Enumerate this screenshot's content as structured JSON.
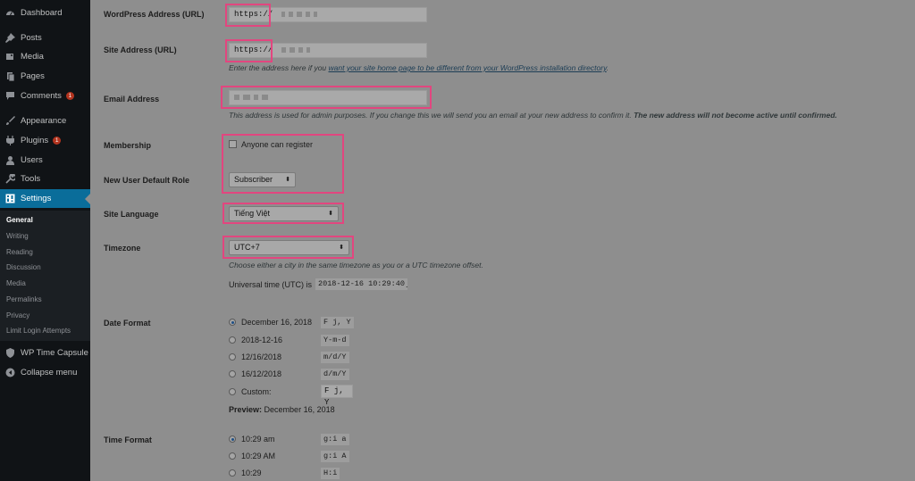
{
  "sidebar": {
    "items": [
      {
        "label": "Dashboard",
        "icon": "dashboard-icon"
      },
      {
        "label": "Posts",
        "icon": "pin-icon"
      },
      {
        "label": "Media",
        "icon": "media-icon"
      },
      {
        "label": "Pages",
        "icon": "pages-icon"
      },
      {
        "label": "Comments",
        "icon": "comment-icon",
        "badge": "1"
      },
      {
        "label": "Appearance",
        "icon": "paintbrush-icon"
      },
      {
        "label": "Plugins",
        "icon": "plug-icon",
        "badge": "1"
      },
      {
        "label": "Users",
        "icon": "user-icon"
      },
      {
        "label": "Tools",
        "icon": "wrench-icon"
      },
      {
        "label": "Settings",
        "icon": "settings-icon",
        "active": true
      },
      {
        "label": "WP Time Capsule",
        "icon": "shield-icon"
      },
      {
        "label": "Collapse menu",
        "icon": "collapse-icon"
      }
    ],
    "submenu": [
      "General",
      "Writing",
      "Reading",
      "Discussion",
      "Media",
      "Permalinks",
      "Privacy",
      "Limit Login Attempts"
    ]
  },
  "form": {
    "wp_address": {
      "label": "WordPress Address (URL)",
      "value": "https://"
    },
    "site_address": {
      "label": "Site Address (URL)",
      "value": "https://",
      "desc_prefix": "Enter the address here if you ",
      "desc_link": "want your site home page to be different from your WordPress installation directory",
      "desc_suffix": "."
    },
    "email": {
      "label": "Email Address",
      "desc": "This address is used for admin purposes. If you change this we will send you an email at your new address to confirm it. ",
      "desc_bold": "The new address will not become active until confirmed."
    },
    "membership": {
      "label": "Membership",
      "checkbox_label": "Anyone can register"
    },
    "default_role": {
      "label": "New User Default Role",
      "value": "Subscriber"
    },
    "site_language": {
      "label": "Site Language",
      "value": "Tiếng Việt"
    },
    "timezone": {
      "label": "Timezone",
      "value": "UTC+7",
      "desc": "Choose either a city in the same timezone as you or a UTC timezone offset.",
      "utc_prefix": "Universal time (UTC) is",
      "utc_value": "2018-12-16 10:29:40",
      "utc_suffix": "."
    },
    "date_format": {
      "label": "Date Format",
      "options": [
        {
          "label": "December 16, 2018",
          "code": "F j, Y",
          "checked": true
        },
        {
          "label": "2018-12-16",
          "code": "Y-m-d",
          "checked": false
        },
        {
          "label": "12/16/2018",
          "code": "m/d/Y",
          "checked": false
        },
        {
          "label": "16/12/2018",
          "code": "d/m/Y",
          "checked": false
        },
        {
          "label": "Custom:",
          "code": "F j, Y",
          "checked": false
        }
      ],
      "preview_label": "Preview:",
      "preview_value": "December 16, 2018"
    },
    "time_format": {
      "label": "Time Format",
      "options": [
        {
          "label": "10:29 am",
          "code": "g:i a",
          "checked": true
        },
        {
          "label": "10:29 AM",
          "code": "g:i A",
          "checked": false
        },
        {
          "label": "10:29",
          "code": "H:i",
          "checked": false
        }
      ]
    }
  },
  "colors": {
    "highlight": "#e2467f",
    "active_menu": "#0a6d9a"
  }
}
